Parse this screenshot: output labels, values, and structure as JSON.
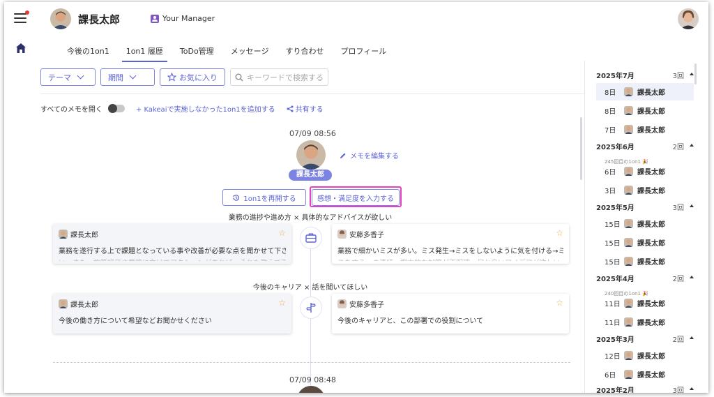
{
  "header": {
    "user_name": "課長太郎",
    "manager_badge": "Your Manager"
  },
  "tabs": [
    "今後の1on1",
    "1on1 履歴",
    "ToDo管理",
    "メッセージ",
    "すり合わせ",
    "プロフィール"
  ],
  "filters": {
    "theme": "テーマ",
    "period": "期間",
    "favorite": "お気に入り",
    "search_placeholder": "キーワードで検索する"
  },
  "memo_bar": {
    "open_all": "すべてのメモを開く",
    "add_link": "+ Kakeaiで実施しなかった1on1を追加する",
    "share": "共有する"
  },
  "session": {
    "timestamp": "07/09 08:56",
    "name": "課長太郎",
    "edit_memo": "メモを編集する",
    "resume_button": "1on1を再開する",
    "feedback_button": "感想・満足度を入力する",
    "topics": [
      {
        "title": "業務の進捗や進め方 × 具体的なアドバイスが欲しい",
        "left": {
          "author": "課長太郎",
          "text": "業務を遂行する上で課題となっている事や改善が必要な点を聞かせて下さ",
          "fade": "い。また、施策評価や業務に向けてアクションがあれば、それも教えて下"
        },
        "right": {
          "author": "安藤多香子",
          "text": "業務で細かいミスが多い。ミス発生→ミスをしないように気を付ける→ミ",
          "fade": "スをする…の連続。根本的な対策が不明確。何か良いアイデアが欲しい"
        }
      },
      {
        "title": "今後のキャリア × 話を聞いてほしい",
        "left": {
          "author": "課長太郎",
          "text": "今後の働き方について希望などお聞かせください",
          "fade": ""
        },
        "right": {
          "author": "安藤多香子",
          "text": "今後のキャリアと、この部署での役割について",
          "fade": ""
        }
      }
    ]
  },
  "next_timestamp": "07/09 08:48",
  "history": [
    {
      "month": "2025年7月",
      "count": "3回",
      "items": [
        {
          "day": "8日",
          "name": "課長太郎",
          "selected": true
        },
        {
          "day": "8日",
          "name": "課長太郎"
        },
        {
          "day": "7日",
          "name": "課長太郎"
        }
      ]
    },
    {
      "month": "2025年6月",
      "count": "2回",
      "note": "245回目の1on1 🎉",
      "items": [
        {
          "day": "6日",
          "name": "課長太郎"
        },
        {
          "day": "3日",
          "name": "課長太郎"
        }
      ]
    },
    {
      "month": "2025年5月",
      "count": "3回",
      "items": [
        {
          "day": "15日",
          "name": "課長太郎"
        },
        {
          "day": "15日",
          "name": "課長太郎"
        },
        {
          "day": "15日",
          "name": "課長太郎"
        }
      ]
    },
    {
      "month": "2025年4月",
      "count": "2回",
      "note": "240回目の1on1 🎉",
      "items": [
        {
          "day": "11日",
          "name": "課長太郎"
        },
        {
          "day": "11日",
          "name": "課長太郎"
        }
      ]
    },
    {
      "month": "2025年3月",
      "count": "2回",
      "items": [
        {
          "day": "12日",
          "name": "課長太郎"
        },
        {
          "day": "6日",
          "name": "課長太郎"
        }
      ]
    },
    {
      "month": "2025年2月",
      "count": "3回",
      "items": []
    }
  ]
}
